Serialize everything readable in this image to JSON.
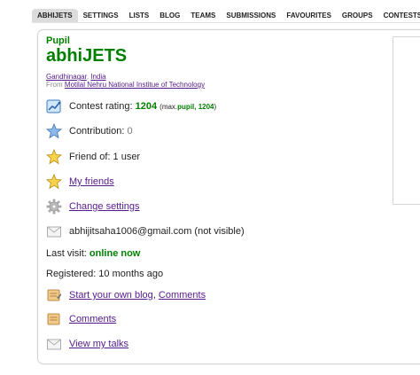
{
  "tabs": [
    {
      "label": "ABHIJETS",
      "active": true
    },
    {
      "label": "SETTINGS",
      "active": false
    },
    {
      "label": "LISTS",
      "active": false
    },
    {
      "label": "BLOG",
      "active": false
    },
    {
      "label": "TEAMS",
      "active": false
    },
    {
      "label": "SUBMISSIONS",
      "active": false
    },
    {
      "label": "FAVOURITES",
      "active": false
    },
    {
      "label": "GROUPS",
      "active": false
    },
    {
      "label": "CONTESTS",
      "active": false
    }
  ],
  "profile": {
    "rank": "Pupil",
    "handle": "abhiJETS",
    "city": "Gandhinagar",
    "country": "India",
    "from_label": "From",
    "organization": "Motilal Nehru National Institue of Technology",
    "rating_label": "Contest rating:",
    "rating_value": "1204",
    "max_open": "(max.",
    "max_rank": "pupil, 1204",
    "max_close": ")",
    "contribution_label": "Contribution:",
    "contribution_value": "0",
    "friend_of": "Friend of: 1 user",
    "my_friends": "My friends",
    "change_settings": "Change settings",
    "email": "abhijitsaha1006@gmail.com (not visible)",
    "last_visit_label": "Last visit:",
    "last_visit_value": "online now",
    "registered": "Registered: 10 months ago",
    "start_blog": "Start your own blog",
    "comments": "Comments",
    "comments2": "Comments",
    "view_talks": "View my talks"
  },
  "icons": {
    "rating": "chart-icon",
    "contribution": "blue-star-icon",
    "friend_of": "gold-star-icon",
    "my_friends": "gold-star-icon",
    "settings": "gear-icon",
    "email": "envelope-icon",
    "blog": "blog-icon",
    "comments": "comments-icon",
    "talks": "envelope-icon"
  },
  "colors": {
    "rank_green": "#008000",
    "link": "#551a8b",
    "tab_active_bg": "#dcdcdc",
    "border": "#d4d4d4"
  }
}
